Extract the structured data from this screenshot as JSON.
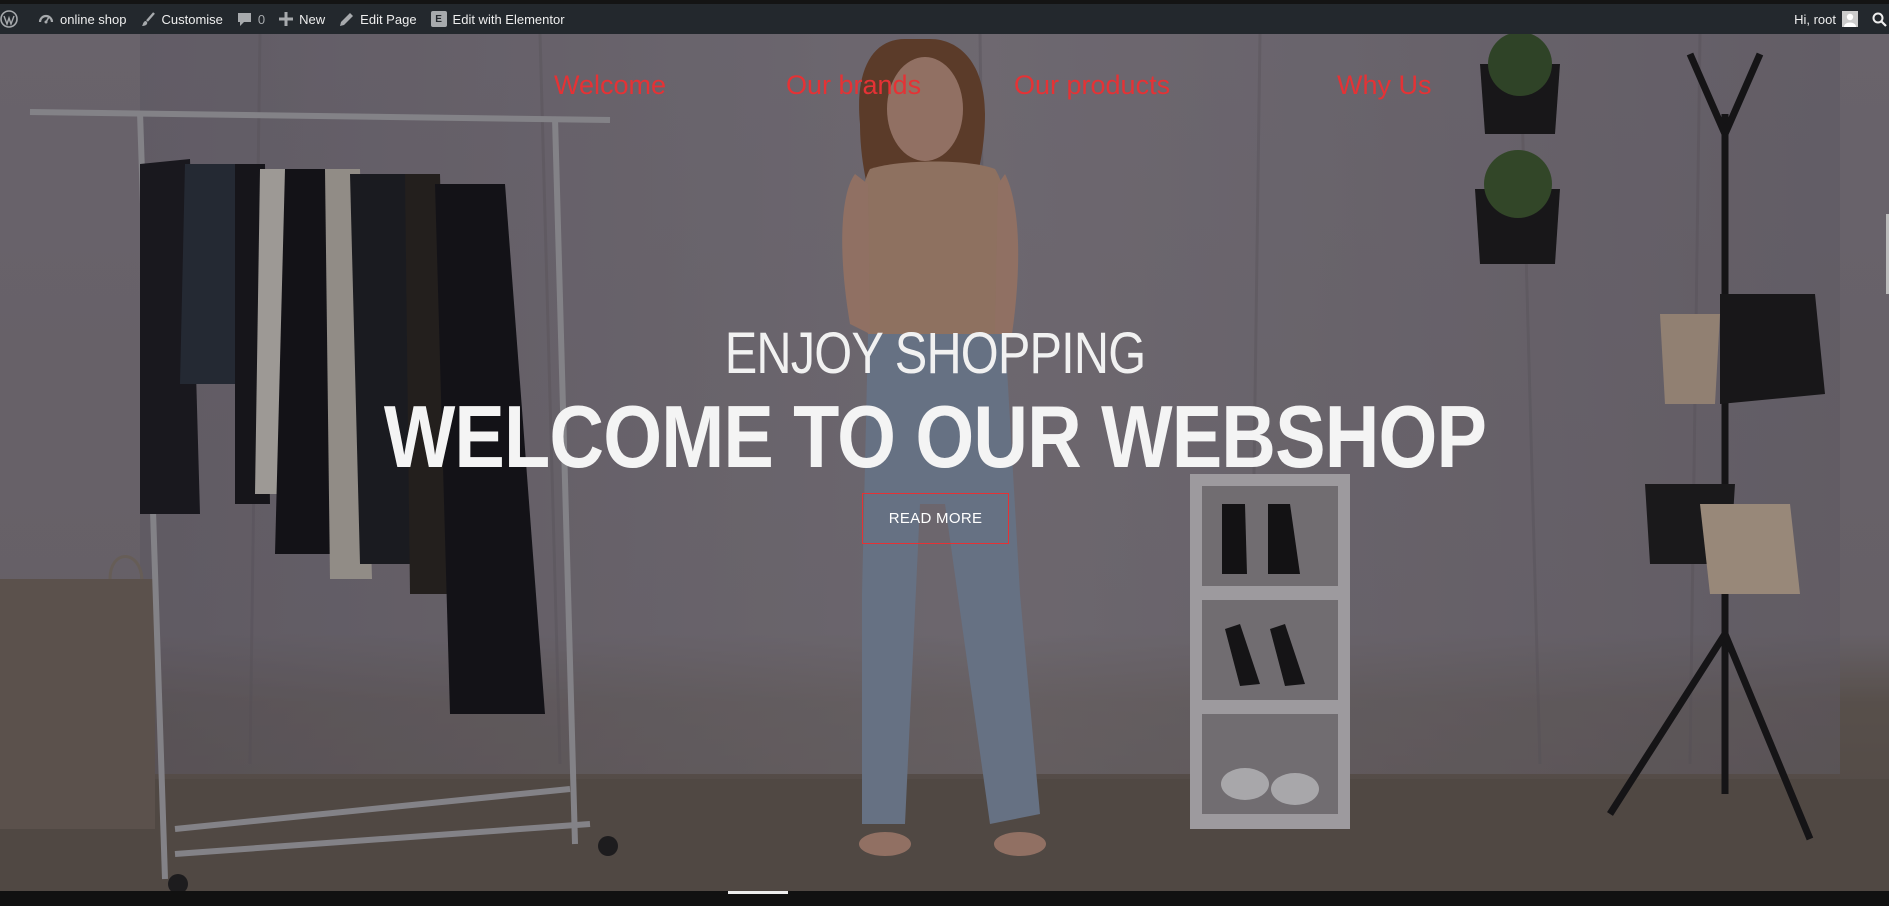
{
  "adminbar": {
    "wp_logo": "wordpress-icon",
    "site_name": "online shop",
    "customise": "Customise",
    "comments_count": "0",
    "new_label": "New",
    "edit_page": "Edit Page",
    "edit_elementor": "Edit with Elementor",
    "elementor_glyph": "E",
    "greeting": "Hi, root"
  },
  "nav": {
    "items": [
      {
        "label": "Welcome"
      },
      {
        "label": "Our brands"
      },
      {
        "label": "Our products"
      },
      {
        "label": "Why Us"
      }
    ]
  },
  "hero": {
    "subtitle": "ENJOY SHOPPING",
    "title": "WELCOME TO OUR WEBSHOP",
    "button": "READ MORE"
  },
  "colors": {
    "accent": "#e53235",
    "adminbar_bg": "#23282d",
    "text_light": "#f4f4f4"
  }
}
